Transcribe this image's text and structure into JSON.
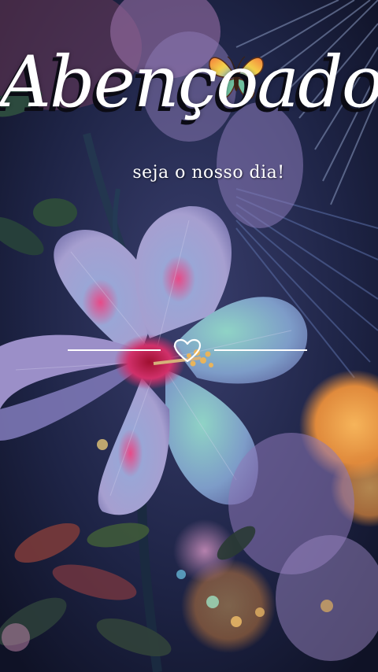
{
  "title": "Abençoado",
  "subtitle": "seja o nosso dia!",
  "colors": {
    "background": "#1b2140",
    "hibiscus_petal": "#b6a9d8",
    "hibiscus_center": "#c8245a",
    "leaf": "#2c4a6e",
    "bokeh_orange": "#f0a04a",
    "text": "#ffffff"
  },
  "decorations": {
    "butterfly": "butterfly-icon",
    "heart": "heart-icon"
  }
}
